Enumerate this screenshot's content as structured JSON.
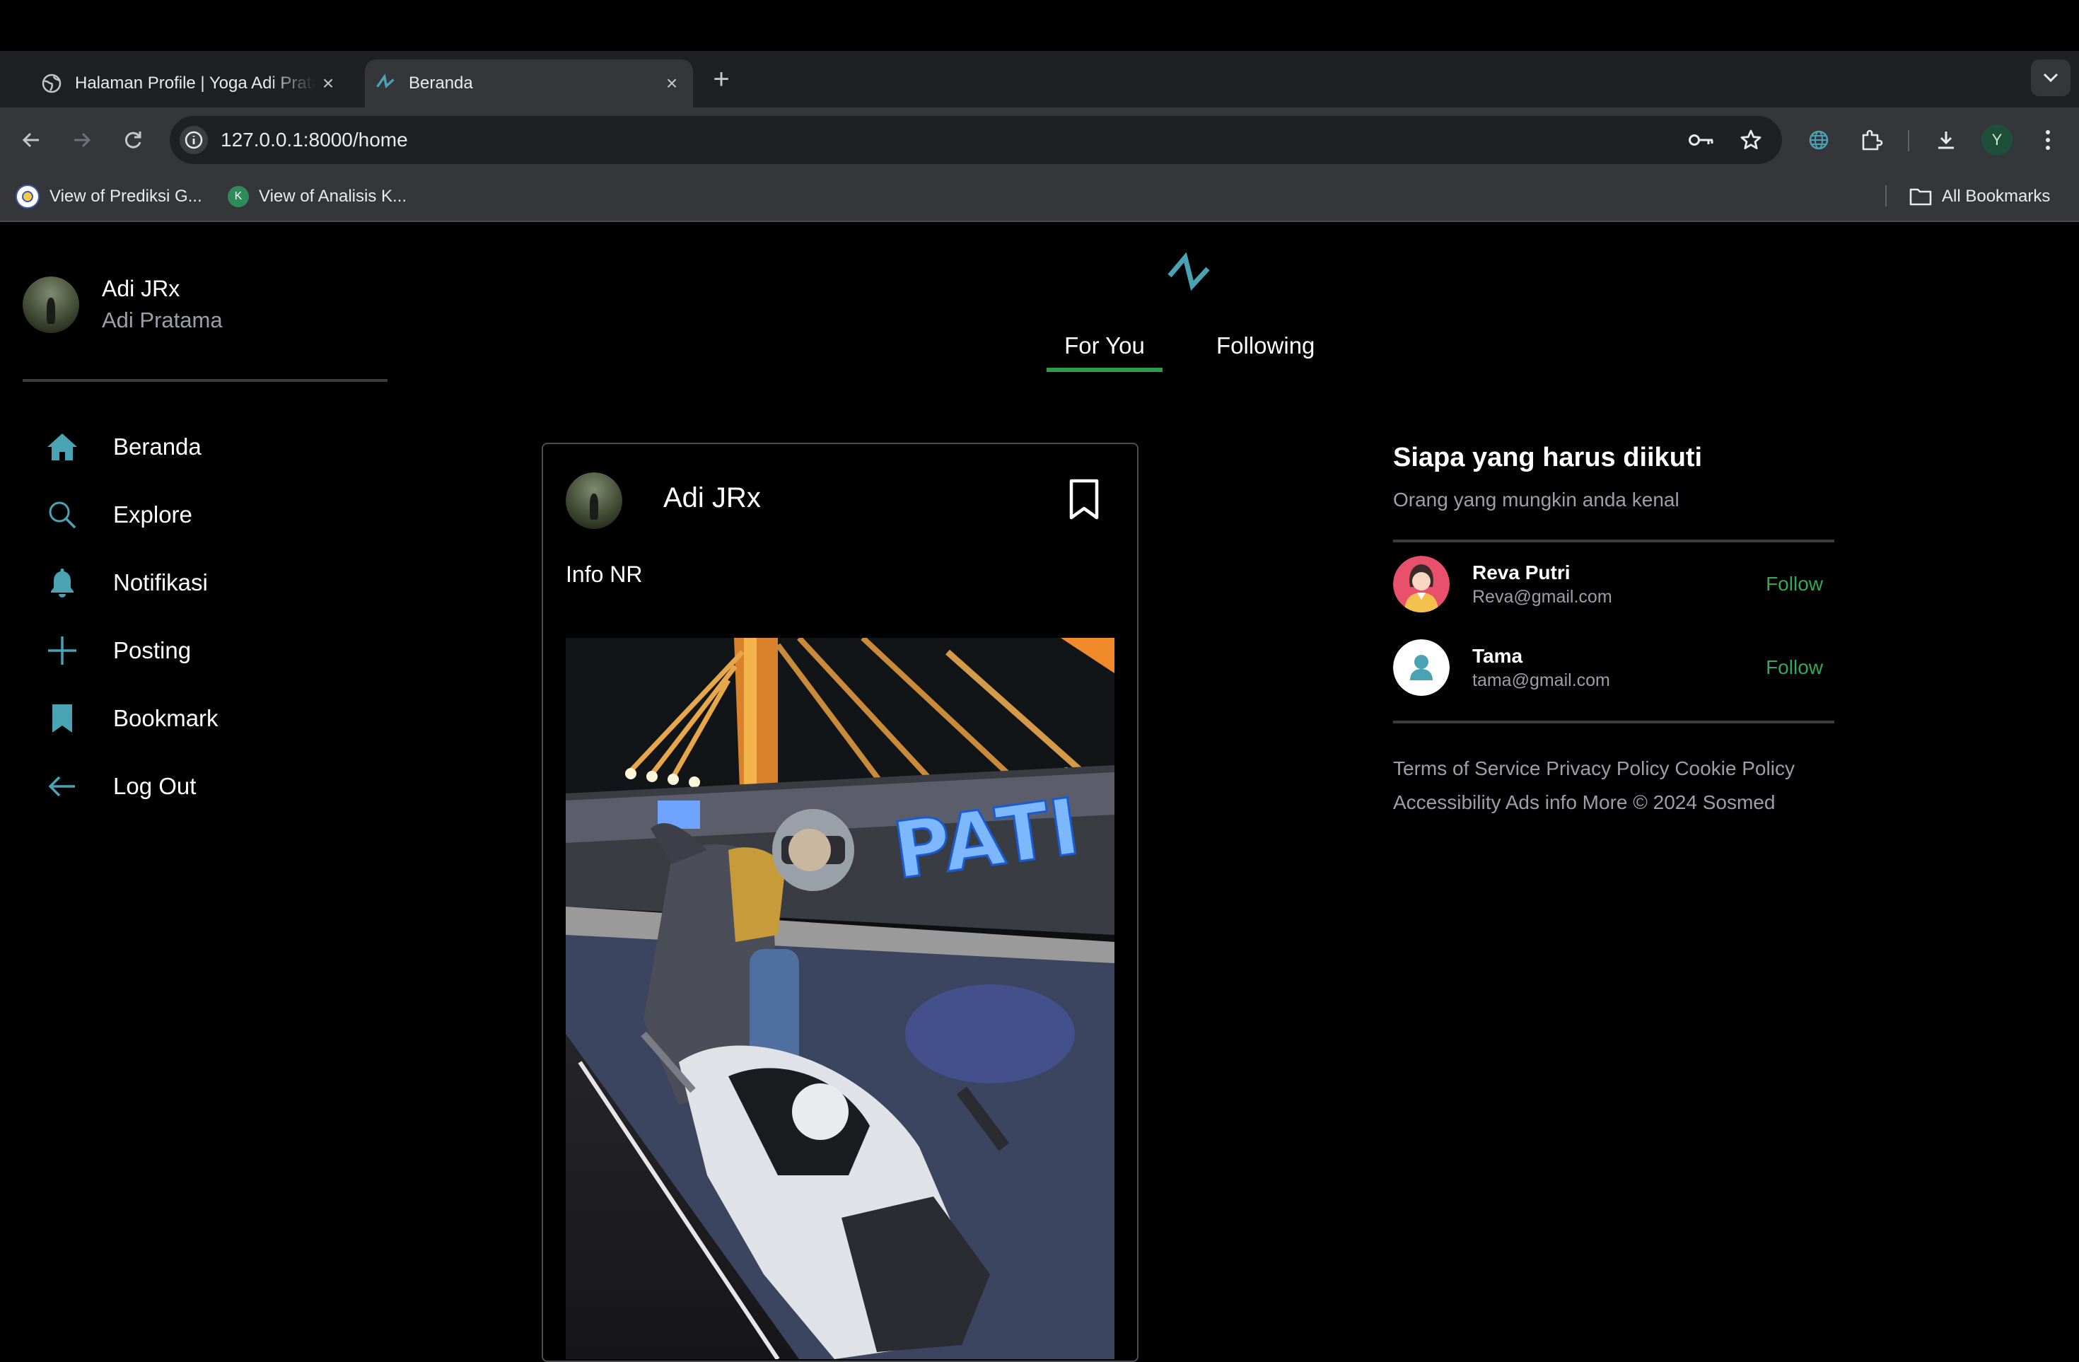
{
  "browser": {
    "tabs": [
      {
        "title": "Halaman Profile | Yoga Adi Pratama",
        "active": false
      },
      {
        "title": "Beranda",
        "active": true
      }
    ],
    "url": "127.0.0.1:8000/home",
    "profile_initial": "Y",
    "bookmarks": [
      {
        "label": "View of Prediksi G...",
        "icon": "seal-icon"
      },
      {
        "label": "View of Analisis K...",
        "icon": "k-icon",
        "icon_text": "K"
      }
    ],
    "all_bookmarks_label": "All Bookmarks"
  },
  "sidebar": {
    "username": "Adi JRx",
    "fullname": "Adi Pratama",
    "nav": [
      {
        "label": "Beranda",
        "icon": "home-icon"
      },
      {
        "label": "Explore",
        "icon": "search-icon"
      },
      {
        "label": "Notifikasi",
        "icon": "bell-icon"
      },
      {
        "label": "Posting",
        "icon": "plus-icon"
      },
      {
        "label": "Bookmark",
        "icon": "bookmark-icon"
      },
      {
        "label": "Log Out",
        "icon": "arrow-left-icon"
      }
    ]
  },
  "feed": {
    "tabs": [
      "For You",
      "Following"
    ],
    "active_tab": "For You",
    "post": {
      "author": "Adi JRx",
      "text": "Info NR",
      "image_sign_text": "PATI"
    }
  },
  "suggestions": {
    "title": "Siapa yang harus diikuti",
    "subtitle": "Orang yang mungkin anda kenal",
    "users": [
      {
        "name": "Reva Putri",
        "email": "Reva@gmail.com",
        "action": "Follow"
      },
      {
        "name": "Tama",
        "email": "tama@gmail.com",
        "action": "Follow"
      }
    ],
    "footer_line1": "Terms of Service Privacy Policy Cookie Policy",
    "footer_line2": "Accessibility Ads info More © 2024 Sosmed"
  },
  "colors": {
    "accent": "#4aa3b3",
    "follow": "#34a853",
    "tab_underline": "#2e9d4a",
    "background": "#000000"
  }
}
